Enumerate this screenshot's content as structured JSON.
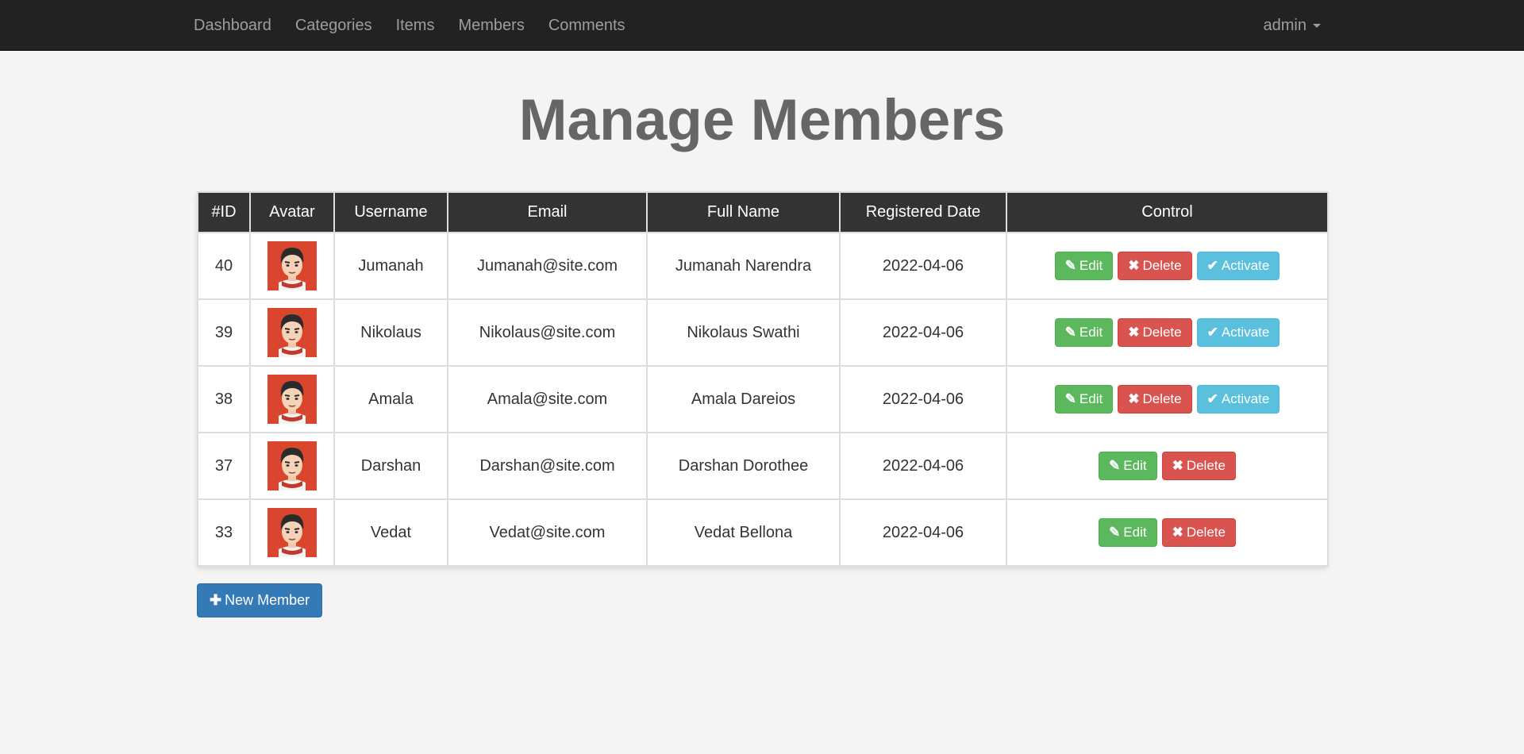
{
  "nav": {
    "links": [
      "Dashboard",
      "Categories",
      "Items",
      "Members",
      "Comments"
    ],
    "user": "admin"
  },
  "page_title": "Manage Members",
  "table": {
    "headers": [
      "#ID",
      "Avatar",
      "Username",
      "Email",
      "Full Name",
      "Registered Date",
      "Control"
    ],
    "rows": [
      {
        "id": "40",
        "username": "Jumanah",
        "email": "Jumanah@site.com",
        "full_name": "Jumanah Narendra",
        "date": "2022-04-06",
        "activate": true
      },
      {
        "id": "39",
        "username": "Nikolaus",
        "email": "Nikolaus@site.com",
        "full_name": "Nikolaus Swathi",
        "date": "2022-04-06",
        "activate": true
      },
      {
        "id": "38",
        "username": "Amala",
        "email": "Amala@site.com",
        "full_name": "Amala Dareios",
        "date": "2022-04-06",
        "activate": true
      },
      {
        "id": "37",
        "username": "Darshan",
        "email": "Darshan@site.com",
        "full_name": "Darshan Dorothee",
        "date": "2022-04-06",
        "activate": false
      },
      {
        "id": "33",
        "username": "Vedat",
        "email": "Vedat@site.com",
        "full_name": "Vedat Bellona",
        "date": "2022-04-06",
        "activate": false
      }
    ]
  },
  "buttons": {
    "edit": "Edit",
    "delete": "Delete",
    "activate": "Activate",
    "new_member": "New Member"
  },
  "icons": {
    "edit": "edit-icon",
    "delete": "times-icon",
    "activate": "check-icon",
    "new_member": "plus-icon",
    "avatar": "avatar-icon"
  },
  "colors": {
    "navbar": "#222222",
    "header": "#333333",
    "success": "#5cb85c",
    "danger": "#d9534f",
    "info": "#5bc0de",
    "primary": "#337ab7"
  }
}
